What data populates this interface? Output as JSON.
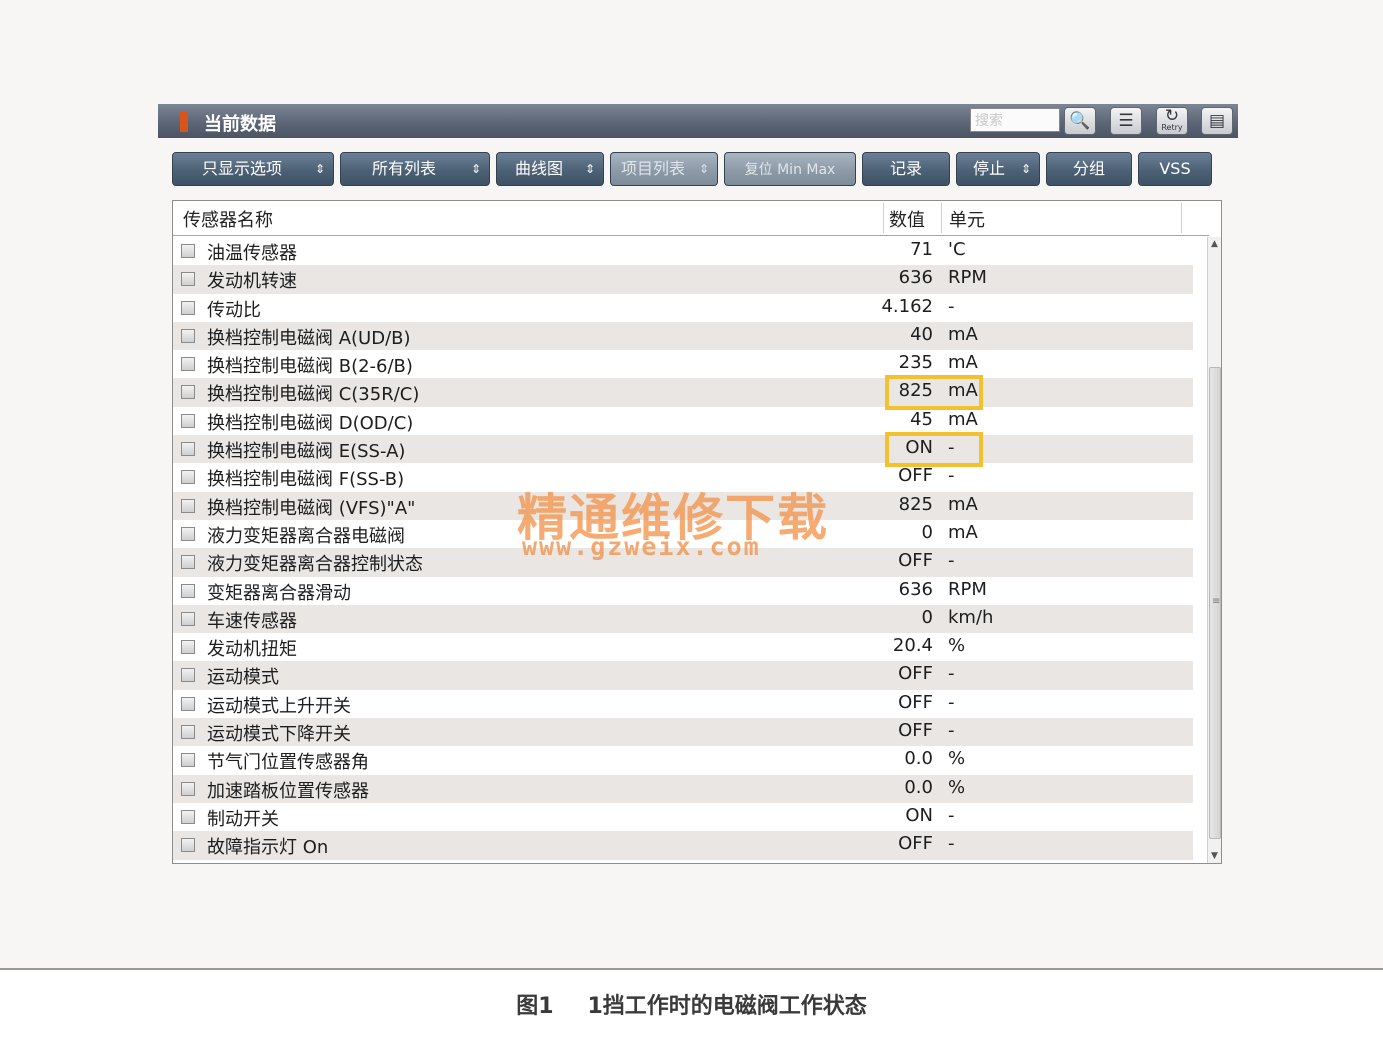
{
  "window": {
    "title": "当前数据",
    "search_placeholder": "搜索"
  },
  "title_icons": [
    {
      "icon": "search-list-icon",
      "glyph": "🔍"
    },
    {
      "icon": "list-icon",
      "glyph": "☰"
    },
    {
      "icon": "retry-icon",
      "glyph": "↻",
      "label": "Retry"
    },
    {
      "icon": "save-icon",
      "glyph": "▤"
    }
  ],
  "toolbar": {
    "buttons": [
      {
        "label": "只显示选项",
        "arrows": "⇕"
      },
      {
        "label": "所有列表",
        "arrows": "⇕"
      },
      {
        "label": "曲线图",
        "arrows": "⇕"
      },
      {
        "label": "项目列表",
        "arrows": "⇕"
      },
      {
        "label": "复位 Min Max",
        "arrows": ""
      },
      {
        "label": "记录",
        "arrows": ""
      },
      {
        "label": "停止",
        "arrows": "⇕"
      },
      {
        "label": "分组",
        "arrows": ""
      },
      {
        "label": "VSS",
        "arrows": ""
      }
    ]
  },
  "table": {
    "headers": {
      "name": "传感器名称",
      "value": "数值",
      "unit": "单元"
    },
    "rows": [
      {
        "name": "油温传感器",
        "value": "71",
        "unit": "'C"
      },
      {
        "name": "发动机转速",
        "value": "636",
        "unit": "RPM"
      },
      {
        "name": "传动比",
        "value": "4.162",
        "unit": "-"
      },
      {
        "name": "换档控制电磁阀 A(UD/B)",
        "value": "40",
        "unit": "mA"
      },
      {
        "name": "换档控制电磁阀 B(2-6/B)",
        "value": "235",
        "unit": "mA"
      },
      {
        "name": "换档控制电磁阀 C(35R/C)",
        "value": "825",
        "unit": "mA"
      },
      {
        "name": "换档控制电磁阀 D(OD/C)",
        "value": "45",
        "unit": "mA"
      },
      {
        "name": "换档控制电磁阀 E(SS-A)",
        "value": "ON",
        "unit": "-"
      },
      {
        "name": "换档控制电磁阀 F(SS-B)",
        "value": "OFF",
        "unit": "-"
      },
      {
        "name": "换档控制电磁阀 (VFS)\"A\"",
        "value": "825",
        "unit": "mA"
      },
      {
        "name": "液力变矩器离合器电磁阀",
        "value": "0",
        "unit": "mA"
      },
      {
        "name": "液力变矩器离合器控制状态",
        "value": "OFF",
        "unit": "-"
      },
      {
        "name": "变矩器离合器滑动",
        "value": "636",
        "unit": "RPM"
      },
      {
        "name": "车速传感器",
        "value": "0",
        "unit": "km/h"
      },
      {
        "name": "发动机扭矩",
        "value": "20.4",
        "unit": "%"
      },
      {
        "name": "运动模式",
        "value": "OFF",
        "unit": "-"
      },
      {
        "name": "运动模式上升开关",
        "value": "OFF",
        "unit": "-"
      },
      {
        "name": "运动模式下降开关",
        "value": "OFF",
        "unit": "-"
      },
      {
        "name": "节气门位置传感器角",
        "value": "0.0",
        "unit": "%"
      },
      {
        "name": "加速踏板位置传感器",
        "value": "0.0",
        "unit": "%"
      },
      {
        "name": "制动开关",
        "value": "ON",
        "unit": "-"
      },
      {
        "name": "故障指示灯 On",
        "value": "OFF",
        "unit": "-"
      }
    ],
    "highlighted_rows": [
      5,
      7
    ],
    "highlight_color": "#f3c12d"
  },
  "watermark": {
    "text": "精通维修下载",
    "url": "www.gzweix.com"
  },
  "caption": {
    "figure": "图1",
    "text": "1挡工作时的电磁阀工作状态"
  }
}
